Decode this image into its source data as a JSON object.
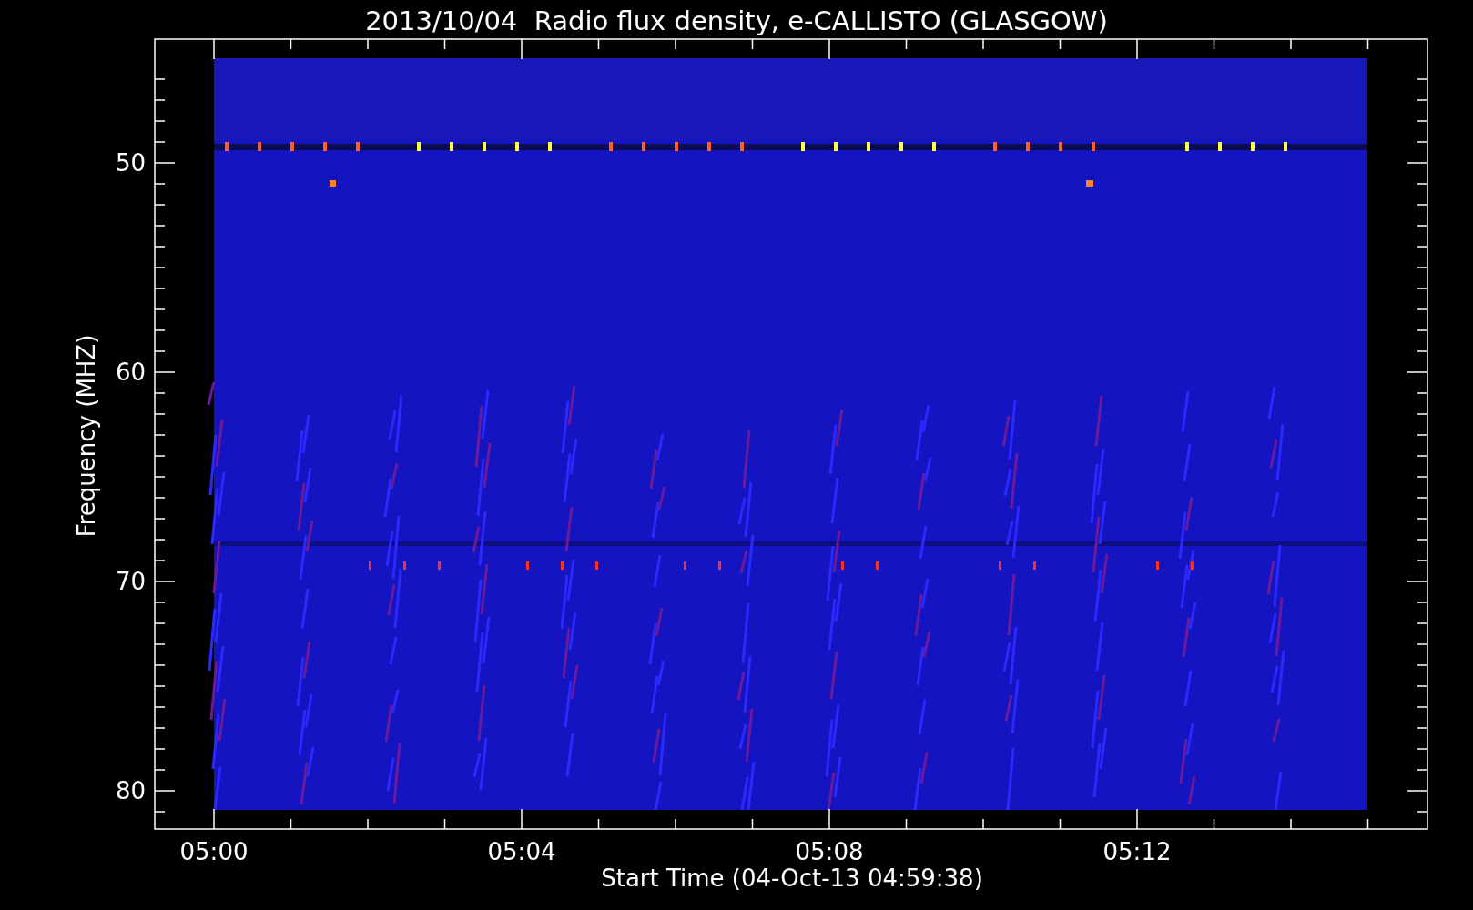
{
  "title": "2013/10/04  Radio flux density, e-CALLISTO (GLASGOW)",
  "y_axis": {
    "label": "Frequency (MHZ)",
    "ticks": [
      "50",
      "60",
      "70",
      "80"
    ]
  },
  "x_axis": {
    "label": "Start Time (04-Oct-13 04:59:38)",
    "ticks": [
      "05:00",
      "05:04",
      "05:08",
      "05:12"
    ]
  }
}
